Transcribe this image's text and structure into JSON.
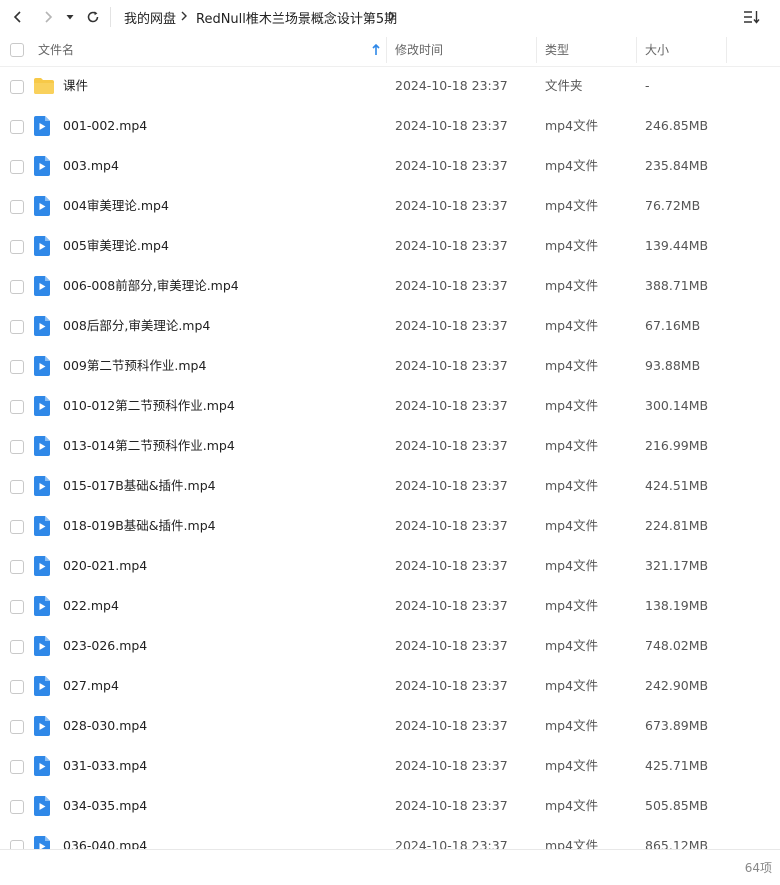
{
  "breadcrumb": [
    "我的网盘",
    "RedNull椎木兰场景概念设计第5期"
  ],
  "header": {
    "name": "文件名",
    "modified": "修改时间",
    "type": "类型",
    "size": "大小"
  },
  "rows": [
    {
      "name": "课件",
      "time": "2024-10-18 23:37",
      "type": "文件夹",
      "size": "-",
      "icon": "folder-icon"
    },
    {
      "name": "001-002.mp4",
      "time": "2024-10-18 23:37",
      "type": "mp4文件",
      "size": "246.85MB",
      "icon": "video-file-icon"
    },
    {
      "name": "003.mp4",
      "time": "2024-10-18 23:37",
      "type": "mp4文件",
      "size": "235.84MB",
      "icon": "video-file-icon"
    },
    {
      "name": "004审美理论.mp4",
      "time": "2024-10-18 23:37",
      "type": "mp4文件",
      "size": "76.72MB",
      "icon": "video-file-icon"
    },
    {
      "name": "005审美理论.mp4",
      "time": "2024-10-18 23:37",
      "type": "mp4文件",
      "size": "139.44MB",
      "icon": "video-file-icon"
    },
    {
      "name": "006-008前部分,审美理论.mp4",
      "time": "2024-10-18 23:37",
      "type": "mp4文件",
      "size": "388.71MB",
      "icon": "video-file-icon"
    },
    {
      "name": "008后部分,审美理论.mp4",
      "time": "2024-10-18 23:37",
      "type": "mp4文件",
      "size": "67.16MB",
      "icon": "video-file-icon"
    },
    {
      "name": "009第二节预科作业.mp4",
      "time": "2024-10-18 23:37",
      "type": "mp4文件",
      "size": "93.88MB",
      "icon": "video-file-icon"
    },
    {
      "name": "010-012第二节预科作业.mp4",
      "time": "2024-10-18 23:37",
      "type": "mp4文件",
      "size": "300.14MB",
      "icon": "video-file-icon"
    },
    {
      "name": "013-014第二节预科作业.mp4",
      "time": "2024-10-18 23:37",
      "type": "mp4文件",
      "size": "216.99MB",
      "icon": "video-file-icon"
    },
    {
      "name": "015-017B基础&插件.mp4",
      "time": "2024-10-18 23:37",
      "type": "mp4文件",
      "size": "424.51MB",
      "icon": "video-file-icon"
    },
    {
      "name": "018-019B基础&插件.mp4",
      "time": "2024-10-18 23:37",
      "type": "mp4文件",
      "size": "224.81MB",
      "icon": "video-file-icon"
    },
    {
      "name": "020-021.mp4",
      "time": "2024-10-18 23:37",
      "type": "mp4文件",
      "size": "321.17MB",
      "icon": "video-file-icon"
    },
    {
      "name": "022.mp4",
      "time": "2024-10-18 23:37",
      "type": "mp4文件",
      "size": "138.19MB",
      "icon": "video-file-icon"
    },
    {
      "name": "023-026.mp4",
      "time": "2024-10-18 23:37",
      "type": "mp4文件",
      "size": "748.02MB",
      "icon": "video-file-icon"
    },
    {
      "name": "027.mp4",
      "time": "2024-10-18 23:37",
      "type": "mp4文件",
      "size": "242.90MB",
      "icon": "video-file-icon"
    },
    {
      "name": "028-030.mp4",
      "time": "2024-10-18 23:37",
      "type": "mp4文件",
      "size": "673.89MB",
      "icon": "video-file-icon"
    },
    {
      "name": "031-033.mp4",
      "time": "2024-10-18 23:37",
      "type": "mp4文件",
      "size": "425.71MB",
      "icon": "video-file-icon"
    },
    {
      "name": "034-035.mp4",
      "time": "2024-10-18 23:37",
      "type": "mp4文件",
      "size": "505.85MB",
      "icon": "video-file-icon"
    },
    {
      "name": "036-040.mp4",
      "time": "2024-10-18 23:37",
      "type": "mp4文件",
      "size": "865.12MB",
      "icon": "video-file-icon"
    }
  ],
  "footer": {
    "item_count": "64项"
  },
  "colors": {
    "accent": "#2f88e8",
    "folder": "#f7c948"
  }
}
